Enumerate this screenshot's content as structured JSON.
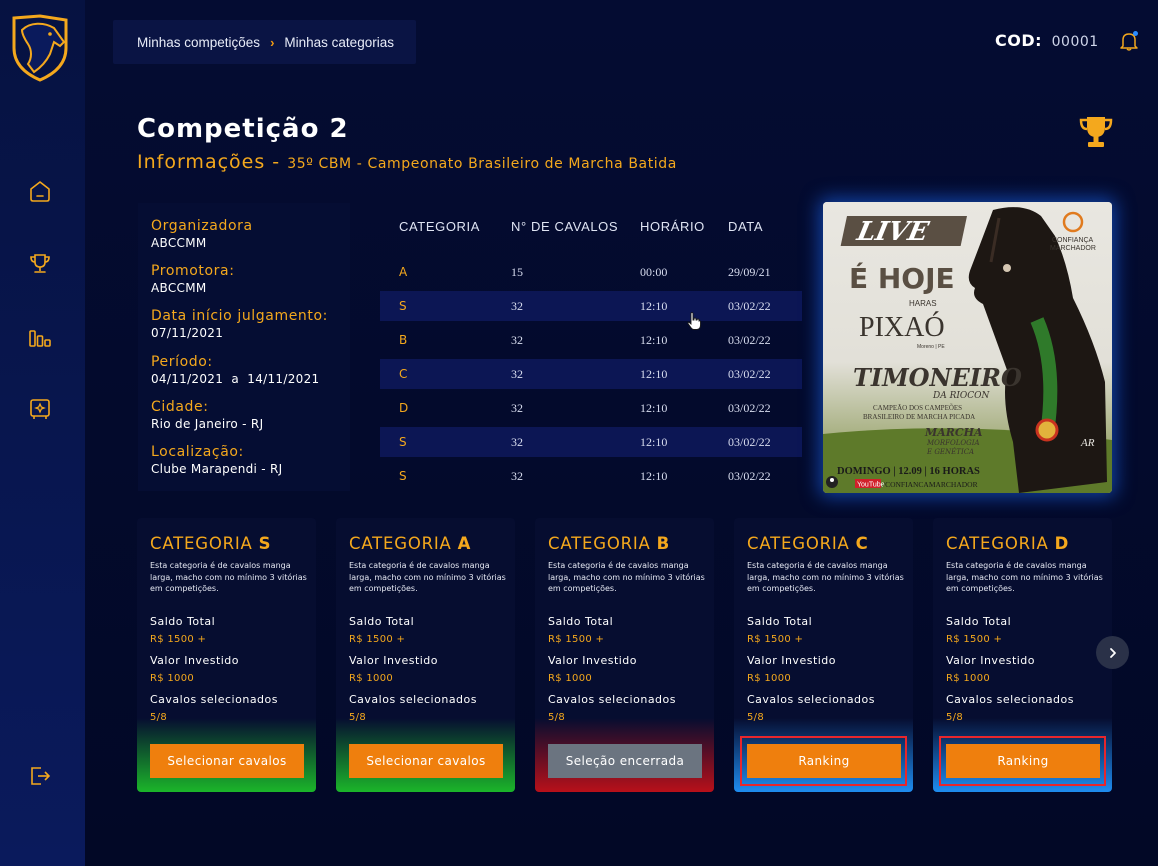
{
  "breadcrumb": {
    "item1": "Minhas competições",
    "separator": "›",
    "item2": "Minhas categorias"
  },
  "header": {
    "cod_label": "COD:",
    "cod_value": "00001"
  },
  "sidebar": {
    "items": [
      "home-icon",
      "trophy-icon",
      "chart-icon",
      "safe-icon",
      "logout-icon"
    ]
  },
  "page": {
    "title": "Competição 2",
    "subtitle_label": "Informações -",
    "subtitle_detail": "35º CBM - Campeonato Brasileiro de Marcha Batida"
  },
  "info": [
    {
      "label": "Organizadora",
      "value": "ABCCMM"
    },
    {
      "label": "Promotora:",
      "value": "ABCCMM"
    },
    {
      "label": "Data início julgamento:",
      "value": " 07/11/2021"
    },
    {
      "label": "Período:",
      "value": "04/11/2021  a  14/11/2021"
    },
    {
      "label": "Cidade:",
      "value": "Rio de Janeiro - RJ"
    },
    {
      "label": "Localização:",
      "value": "Clube Marapendi - RJ"
    }
  ],
  "table": {
    "headers": [
      "CATEGORIA",
      "N° DE CAVALOS",
      "HORÁRIO",
      "DATA"
    ],
    "rows": [
      [
        "A",
        "15",
        "00:00",
        "29/09/21"
      ],
      [
        "S",
        "32",
        "12:10",
        "03/02/22"
      ],
      [
        "B",
        "32",
        "12:10",
        "03/02/22"
      ],
      [
        "C",
        "32",
        "12:10",
        "03/02/22"
      ],
      [
        "D",
        "32",
        "12:10",
        "03/02/22"
      ],
      [
        "S",
        "32",
        "12:10",
        "03/02/22"
      ],
      [
        "S",
        "32",
        "12:10",
        "03/02/22"
      ]
    ]
  },
  "poster": {
    "live": "LIVE",
    "e_hoje": "É HOJE",
    "haras": "HARAS",
    "brand": "PIXAÓ",
    "place": "Moreno | PE",
    "horse": "TIMONEIRO",
    "horse_sub": "DA RIOCON",
    "desc1": "CAMPEÃO DOS CAMPEÕES",
    "desc2": "BRASILEIRO DE MARCHA PICADA",
    "marcha1": "MARCHA",
    "marcha2": "MORFOLOGIA",
    "marcha3": "E GENÉTICA",
    "sponsor1": "CONFIANÇA",
    "sponsor2": "MARCHADOR",
    "date_line": "DOMINGO | 12.09 | 16 HORAS",
    "yt": "YouTube",
    "channel": "/CONFIANCAMARCHADOR",
    "sig": "AR"
  },
  "cards": [
    {
      "prefix": "CATEGORIA ",
      "letter": "S",
      "desc": "Esta categoria é de cavalos manga larga, macho com no mínimo 3 vitórias em competições.",
      "saldo_label": "Saldo Total",
      "saldo": "R$ 1500 +",
      "invest_label": "Valor Investido",
      "invest": "R$ 1000",
      "sel_label": "Cavalos selecionados",
      "sel": "5/8",
      "button": "Selecionar cavalos",
      "glow": "#1bb52a"
    },
    {
      "prefix": "CATEGORIA ",
      "letter": "A",
      "desc": "Esta categoria é de cavalos manga larga, macho com no mínimo 3 vitórias em competições.",
      "saldo_label": "Saldo Total",
      "saldo": "R$ 1500 +",
      "invest_label": "Valor Investido",
      "invest": "R$ 1000",
      "sel_label": "Cavalos selecionados",
      "sel": "5/8",
      "button": "Selecionar cavalos",
      "glow": "#1bb52a"
    },
    {
      "prefix": "CATEGORIA ",
      "letter": "B",
      "desc": "Esta categoria é de cavalos manga larga, macho com no mínimo 3 vitórias em competições.",
      "saldo_label": "Saldo Total",
      "saldo": "R$ 1500 +",
      "invest_label": "Valor Investido",
      "invest": "R$ 1000",
      "sel_label": "Cavalos selecionados",
      "sel": "5/8",
      "button": "Seleção encerrada",
      "glow": "#b8101a"
    },
    {
      "prefix": "CATEGORIA ",
      "letter": "C",
      "desc": "Esta categoria é de cavalos manga larga, macho com no mínimo 3 vitórias em competições.",
      "saldo_label": "Saldo Total",
      "saldo": "R$ 1500 +",
      "invest_label": "Valor Investido",
      "invest": "R$ 1000",
      "sel_label": "Cavalos selecionados",
      "sel": "5/8",
      "button": "Ranking",
      "glow": "#1e8cf0"
    },
    {
      "prefix": "CATEGORIA ",
      "letter": "D",
      "desc": "Esta categoria é de cavalos manga larga, macho com no mínimo 3 vitórias em competições.",
      "saldo_label": "Saldo Total",
      "saldo": "R$ 1500 +",
      "invest_label": "Valor Investido",
      "invest": "R$ 1000",
      "sel_label": "Cavalos selecionados",
      "sel": "5/8",
      "button": "Ranking",
      "glow": "#1e8cf0"
    }
  ],
  "colors": {
    "accent": "#f4a81d",
    "button": "#ef7f0d",
    "background": "#030a2e",
    "stripe": "#0c1654"
  }
}
